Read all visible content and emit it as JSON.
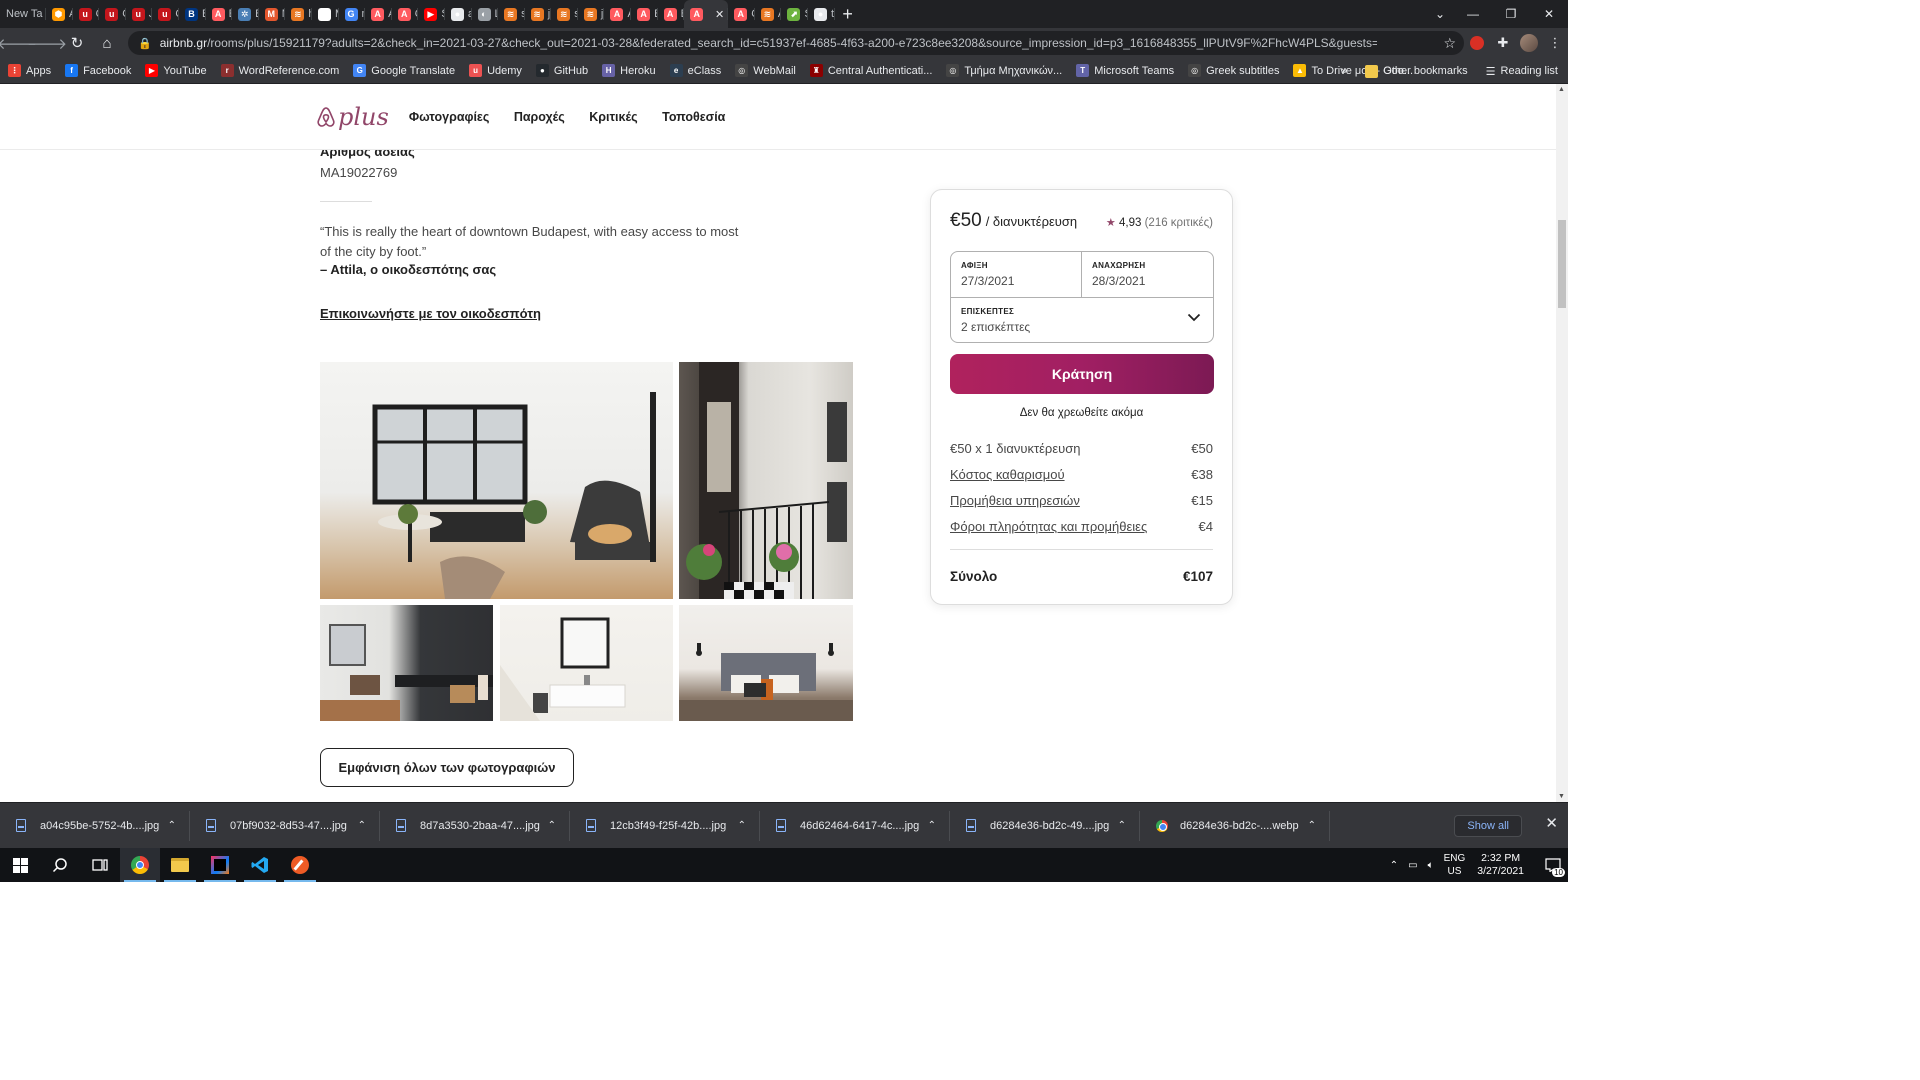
{
  "browser": {
    "tabs": [
      {
        "label": "New Ta",
        "color": "#3c4043",
        "glyph": ""
      },
      {
        "label": "AW",
        "color": "#ff9900",
        "glyph": "⬢"
      },
      {
        "label": "Or",
        "color": "#c4161c",
        "glyph": "u"
      },
      {
        "label": "Gc",
        "color": "#c4161c",
        "glyph": "u"
      },
      {
        "label": "Jav",
        "color": "#c4161c",
        "glyph": "u"
      },
      {
        "label": "OA",
        "color": "#c4161c",
        "glyph": "u"
      },
      {
        "label": "Bo",
        "color": "#003580",
        "glyph": "B"
      },
      {
        "label": "Ev",
        "color": "#ff5a5f",
        "glyph": "A"
      },
      {
        "label": "Bo",
        "color": "#4a7fb5",
        "glyph": "✲"
      },
      {
        "label": "My",
        "color": "#e4572e",
        "glyph": "M"
      },
      {
        "label": "hit",
        "color": "#e87722",
        "glyph": "≋"
      },
      {
        "label": "My",
        "color": "#ffffff",
        "glyph": "W"
      },
      {
        "label": "my",
        "color": "#4285f4",
        "glyph": "G"
      },
      {
        "label": "Αθ",
        "color": "#ff5a5f",
        "glyph": "A"
      },
      {
        "label": "Ol",
        "color": "#ff5a5f",
        "glyph": "A"
      },
      {
        "label": "Sp",
        "color": "#ff0000",
        "glyph": "▶"
      },
      {
        "label": "am",
        "color": "#e8eaed",
        "glyph": "●"
      },
      {
        "label": "Lo",
        "color": "#9aa0a6",
        "glyph": "◐"
      },
      {
        "label": "sp",
        "color": "#e87722",
        "glyph": "≋"
      },
      {
        "label": "jav",
        "color": "#e87722",
        "glyph": "≋"
      },
      {
        "label": "sp",
        "color": "#e87722",
        "glyph": "≋"
      },
      {
        "label": "jav",
        "color": "#e87722",
        "glyph": "≋"
      },
      {
        "label": "Αθ",
        "color": "#ff5a5f",
        "glyph": "A"
      },
      {
        "label": "Be",
        "color": "#ff5a5f",
        "glyph": "A"
      },
      {
        "label": "Bo",
        "color": "#ff5a5f",
        "glyph": "A"
      },
      {
        "label": "",
        "color": "#ff5a5f",
        "glyph": "A",
        "active": true
      },
      {
        "label": "Cu",
        "color": "#ff5a5f",
        "glyph": "A"
      },
      {
        "label": "Ad",
        "color": "#e87722",
        "glyph": "≋"
      },
      {
        "label": "Sp",
        "color": "#6db33f",
        "glyph": "⬈"
      },
      {
        "label": "tut",
        "color": "#e8eaed",
        "glyph": "●"
      }
    ],
    "new_tab_glyph": "+",
    "window_controls": {
      "minimize": "—",
      "maximize": "❐",
      "close": "✕"
    },
    "url_host": "airbnb.gr",
    "url_path": "/rooms/plus/15921179?adults=2&check_in=2021-03-27&check_out=2021-03-28&federated_search_id=c51937ef-4685-4f63-a200-e723c8ee3208&source_impression_id=p3_1616848355_llPUtV9F%2FhcW4PLS&guests=1",
    "bookmarks": [
      {
        "label": "Apps",
        "color": "#ea4335",
        "glyph": "⋮"
      },
      {
        "label": "Facebook",
        "color": "#1877f2",
        "glyph": "f"
      },
      {
        "label": "YouTube",
        "color": "#ff0000",
        "glyph": "▶"
      },
      {
        "label": "WordReference.com",
        "color": "#8b2f2f",
        "glyph": "r"
      },
      {
        "label": "Google Translate",
        "color": "#4285f4",
        "glyph": "G"
      },
      {
        "label": "Udemy",
        "color": "#ec5252",
        "glyph": "u"
      },
      {
        "label": "GitHub",
        "color": "#24292e",
        "glyph": "●"
      },
      {
        "label": "Heroku",
        "color": "#6762a6",
        "glyph": "H"
      },
      {
        "label": "eClass",
        "color": "#2c3e50",
        "glyph": "e"
      },
      {
        "label": "WebMail",
        "color": "#444",
        "glyph": "◎"
      },
      {
        "label": "Central Authenticati...",
        "color": "#8b0000",
        "glyph": "♜"
      },
      {
        "label": "Τμήμα Μηχανικών...",
        "color": "#444",
        "glyph": "◎"
      },
      {
        "label": "Microsoft Teams",
        "color": "#6264a7",
        "glyph": "T"
      },
      {
        "label": "Greek subtitles",
        "color": "#444",
        "glyph": "◎"
      },
      {
        "label": "To Drive μου - Goo...",
        "color": "#fbbc05",
        "glyph": "▲"
      }
    ],
    "bookmarks_overflow": "»",
    "other_bookmarks": "Other bookmarks",
    "reading_list": "Reading list"
  },
  "site": {
    "logo_text": "plus",
    "nav": [
      "Φωτογραφίες",
      "Παροχές",
      "Κριτικές",
      "Τοποθεσία"
    ]
  },
  "listing": {
    "license_label": "Αριθμός άδειας",
    "license_value": "MA19022769",
    "quote": "“This is really the heart of downtown Budapest, with easy access to most of the city by foot.”",
    "quote_author": "– Attila, ο οικοδεσπότης σας",
    "contact_host": "Επικοινωνήστε με τον οικοδεσπότη",
    "show_all_photos": "Εμφάνιση όλων των φωτογραφιών"
  },
  "booking": {
    "price": "€50",
    "per_night": "/ διανυκτέρευση",
    "rating": "4,93",
    "reviews": "(216 κριτικές)",
    "checkin_label": "ΑΦΙΞΗ",
    "checkin_value": "27/3/2021",
    "checkout_label": "ΑΝΑΧΩΡΗΣΗ",
    "checkout_value": "28/3/2021",
    "guests_label": "ΕΠΙΣΚΕΠΤΕΣ",
    "guests_value": "2 επισκέπτες",
    "reserve_button": "Κράτηση",
    "no_charge_note": "Δεν θα χρεωθείτε ακόμα",
    "fees": [
      {
        "label": "€50 x 1 διανυκτέρευση",
        "value": "€50",
        "underline": false
      },
      {
        "label": "Κόστος καθαρισμού",
        "value": "€38",
        "underline": true
      },
      {
        "label": "Προμήθεια υπηρεσιών",
        "value": "€15",
        "underline": true
      },
      {
        "label": "Φόροι πληρότητας και προμήθειες",
        "value": "€4",
        "underline": true
      }
    ],
    "total_label": "Σύνολο",
    "total_value": "€107",
    "accent_color": "#a11f63"
  },
  "downloads": {
    "items": [
      {
        "name": "a04c95be-5752-4b....jpg",
        "kind": "file"
      },
      {
        "name": "07bf9032-8d53-47....jpg",
        "kind": "file"
      },
      {
        "name": "8d7a3530-2baa-47....jpg",
        "kind": "file"
      },
      {
        "name": "12cb3f49-f25f-42b....jpg",
        "kind": "file"
      },
      {
        "name": "46d62464-6417-4c....jpg",
        "kind": "file"
      },
      {
        "name": "d6284e36-bd2c-49....jpg",
        "kind": "file"
      },
      {
        "name": "d6284e36-bd2c-....webp",
        "kind": "chrome"
      }
    ],
    "show_all": "Show all"
  },
  "taskbar": {
    "lang_top": "ENG",
    "lang_bottom": "US",
    "time": "2:32 PM",
    "date": "3/27/2021",
    "notification_count": "10"
  }
}
